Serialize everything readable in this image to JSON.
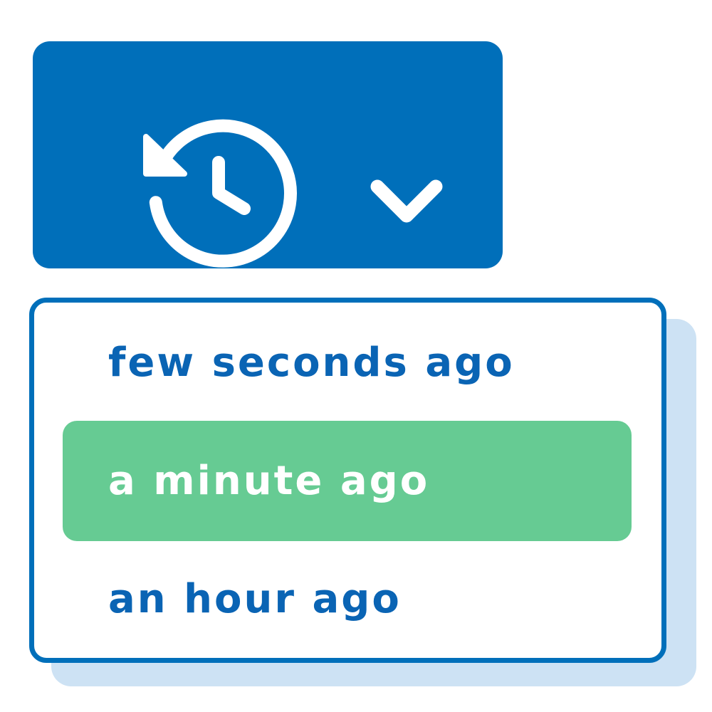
{
  "history_button": {
    "icon": "history-icon",
    "dropdown_icon": "chevron-down-icon",
    "background_color": "#006fba"
  },
  "dropdown": {
    "border_color": "#006fba",
    "shadow_color": "#cde2f4",
    "selected_color": "#66cb93",
    "items": [
      {
        "label": "few seconds ago",
        "selected": false
      },
      {
        "label": "a minute ago",
        "selected": true
      },
      {
        "label": "an hour ago",
        "selected": false
      }
    ]
  }
}
